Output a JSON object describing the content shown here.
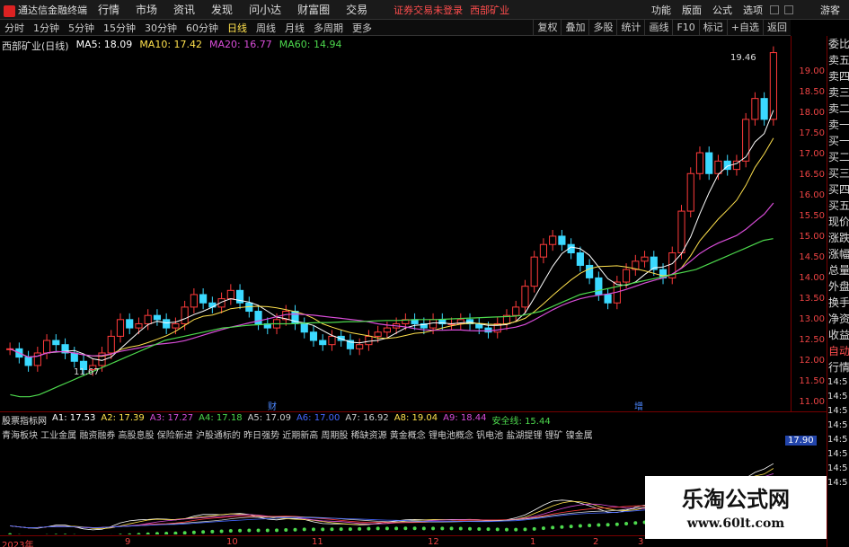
{
  "app": {
    "title": "通达信金融终端"
  },
  "menu": [
    "行情",
    "市场",
    "资讯",
    "发现",
    "问小达",
    "财富圈",
    "交易"
  ],
  "warning": "证券交易未登录",
  "stock_name": "西部矿业",
  "right_menu": [
    "功能",
    "版面",
    "公式",
    "选项"
  ],
  "guest": "游客",
  "periods": [
    {
      "label": "分时",
      "active": false
    },
    {
      "label": "1分钟",
      "active": false
    },
    {
      "label": "5分钟",
      "active": false
    },
    {
      "label": "15分钟",
      "active": false
    },
    {
      "label": "30分钟",
      "active": false
    },
    {
      "label": "60分钟",
      "active": false
    },
    {
      "label": "日线",
      "active": true
    },
    {
      "label": "周线",
      "active": false
    },
    {
      "label": "月线",
      "active": false
    },
    {
      "label": "多周期",
      "active": false
    },
    {
      "label": "更多",
      "active": false
    }
  ],
  "toolbar": [
    "复权",
    "叠加",
    "多股",
    "统计",
    "画线",
    "F10",
    "标记",
    "+自选",
    "返回"
  ],
  "chart": {
    "title": "西部矿业(日线)",
    "ma": [
      {
        "label": "MA5: 18.09",
        "color": "#ffffff"
      },
      {
        "label": "MA10: 17.42",
        "color": "#ffe14d"
      },
      {
        "label": "MA20: 16.77",
        "color": "#d94dd9"
      },
      {
        "label": "MA60: 14.94",
        "color": "#4dd94d"
      }
    ],
    "high_label": "19.46",
    "low_label": "11.67",
    "marker_cai": "财",
    "marker_zeng": "增"
  },
  "price_ticks": [
    "19.00",
    "18.50",
    "18.00",
    "17.50",
    "17.00",
    "16.50",
    "16.00",
    "15.50",
    "15.00",
    "14.50",
    "14.00",
    "13.50",
    "13.00",
    "12.50",
    "12.00",
    "11.50",
    "11.00"
  ],
  "indicator": {
    "name": "股票指标网",
    "values": [
      {
        "label": "A1: 17.53",
        "color": "#ffffff"
      },
      {
        "label": "A2: 17.39",
        "color": "#ffe14d"
      },
      {
        "label": "A3: 17.27",
        "color": "#d94dd9"
      },
      {
        "label": "A4: 17.18",
        "color": "#4dd94d"
      },
      {
        "label": "A5: 17.09",
        "color": "#cccccc"
      },
      {
        "label": "A6: 17.00",
        "color": "#4466ff"
      },
      {
        "label": "A7: 16.92",
        "color": "#cccccc"
      },
      {
        "label": "A8: 19.04",
        "color": "#ffe14d"
      },
      {
        "label": "A9: 18.44",
        "color": "#d94dd9"
      },
      {
        "label": "安全线: 15.44",
        "color": "#4dd94d"
      }
    ],
    "tags": "青海板块 工业金属 融资融券 高股息股 保险新进 沪股通标的 昨日强势 近期新高 周期股 稀缺资源 黄金概念 锂电池概念 钒电池 盐湖提锂 锂矿 镍金属",
    "axis_label": "17.90"
  },
  "dates": [
    "2023年",
    "9",
    "10",
    "11",
    "12",
    "1",
    "2",
    "3"
  ],
  "side_panel": [
    "委比",
    "卖五",
    "卖四",
    "卖三",
    "卖二",
    "卖一",
    "买一",
    "买二",
    "买三",
    "买四",
    "买五",
    "现价",
    "涨跌",
    "涨幅",
    "总量",
    "外盘",
    "换手",
    "净资",
    "收益",
    "自动",
    "行情"
  ],
  "side_times": [
    "14:5",
    "14:5",
    "14:5",
    "14:5",
    "14:5",
    "14:5",
    "14:5",
    "14:5"
  ],
  "watermark": {
    "title": "乐淘公式网",
    "url": "www.60lt.com"
  },
  "chart_data": {
    "type": "line",
    "title": "西部矿业(日线)",
    "ylim": [
      10.8,
      19.8
    ],
    "series": [
      {
        "name": "K",
        "values": [
          12.3,
          12.1,
          11.9,
          12.2,
          12.5,
          12.4,
          12.2,
          12.0,
          11.8,
          11.9,
          12.2,
          12.6,
          13.0,
          12.8,
          12.9,
          13.1,
          13.0,
          12.8,
          12.9,
          13.3,
          13.6,
          13.4,
          13.3,
          13.5,
          13.7,
          13.4,
          13.2,
          12.9,
          12.8,
          13.0,
          13.2,
          12.9,
          12.7,
          12.5,
          12.4,
          12.6,
          12.5,
          12.3,
          12.4,
          12.6,
          12.7,
          12.8,
          12.9,
          13.0,
          12.9,
          12.8,
          13.0,
          12.9,
          12.9,
          13.0,
          12.9,
          12.8,
          12.7,
          12.9,
          13.1,
          13.3,
          13.8,
          14.5,
          14.8,
          15.0,
          14.8,
          14.6,
          14.3,
          14.0,
          13.6,
          13.4,
          13.9,
          14.2,
          14.4,
          14.5,
          14.2,
          14.0,
          14.6,
          15.6,
          16.5,
          17.0,
          16.5,
          16.8,
          16.6,
          16.8,
          17.8,
          18.3,
          17.8,
          19.4
        ]
      },
      {
        "name": "MA60",
        "values": [
          11.2,
          11.15,
          11.15,
          11.2,
          11.3,
          11.4,
          11.5,
          11.6,
          11.7,
          11.8,
          11.9,
          12.0,
          12.1,
          12.2,
          12.3,
          12.4,
          12.5,
          12.55,
          12.6,
          12.65,
          12.7,
          12.75,
          12.8,
          12.82,
          12.85,
          12.87,
          12.88,
          12.9,
          12.9,
          12.9,
          12.91,
          12.92,
          12.93,
          12.93,
          12.94,
          12.95,
          12.95,
          12.96,
          12.97,
          12.98,
          12.98,
          12.99,
          13.0,
          13.0,
          13.0,
          13.01,
          13.02,
          13.03,
          13.04,
          13.05,
          13.06,
          13.07,
          13.08,
          13.1,
          13.15,
          13.2,
          13.3,
          13.4,
          13.5,
          13.6,
          13.65,
          13.7,
          13.75,
          13.8,
          13.85,
          13.9,
          13.95,
          14.0,
          14.05,
          14.1,
          14.15,
          14.2,
          14.3,
          14.4,
          14.5,
          14.6,
          14.7,
          14.8,
          14.9,
          14.94
        ]
      }
    ]
  }
}
